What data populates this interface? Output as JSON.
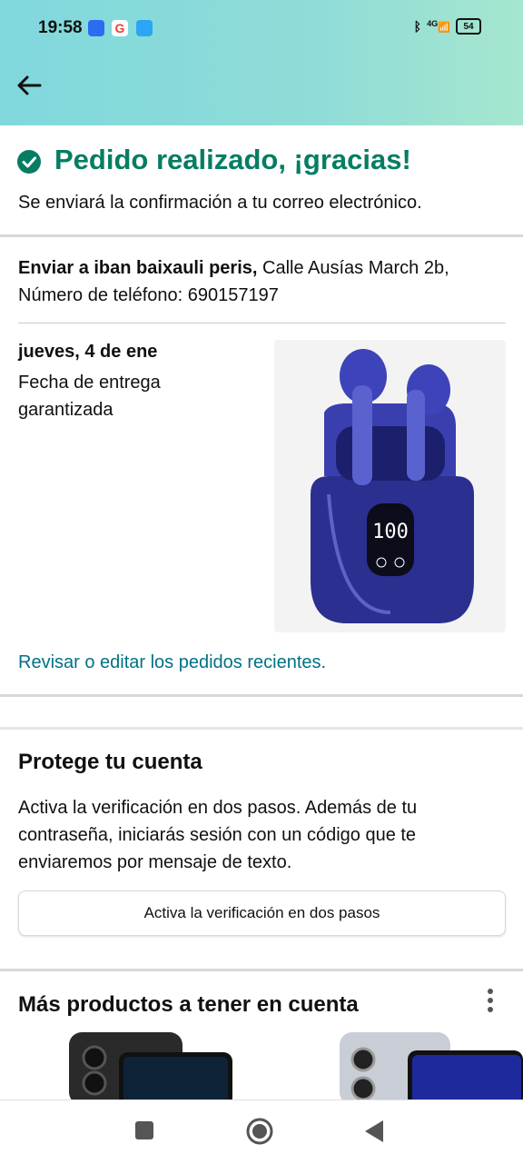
{
  "status_bar": {
    "time": "19:58",
    "network": "4G",
    "battery": "54"
  },
  "header": {
    "back_icon": "back-arrow-icon"
  },
  "confirmation": {
    "title": "Pedido realizado, ¡gracias!",
    "subtitle": "Se enviará la confirmación a tu correo electrónico."
  },
  "shipping": {
    "label": "Enviar a iban baixauli peris,",
    "address": "Calle Ausías March 2b, Número de teléfono: 690157197"
  },
  "delivery": {
    "date": "jueves, 4 de ene",
    "note": "Fecha de entrega garantizada"
  },
  "review_link": "Revisar o editar los pedidos recientes.",
  "protect": {
    "title": "Protege tu cuenta",
    "body": "Activa la verificación en dos pasos. Además de tu contraseña, iniciarás sesión con un código que te enviaremos por mensaje de texto.",
    "button": "Activa la verificación en dos pasos"
  },
  "more": {
    "title": "Más productos a tener en cuenta"
  },
  "colors": {
    "success": "#067d62",
    "link": "#007185",
    "header_gradient_start": "#80d8dc",
    "header_gradient_end": "#a6e6cf"
  }
}
